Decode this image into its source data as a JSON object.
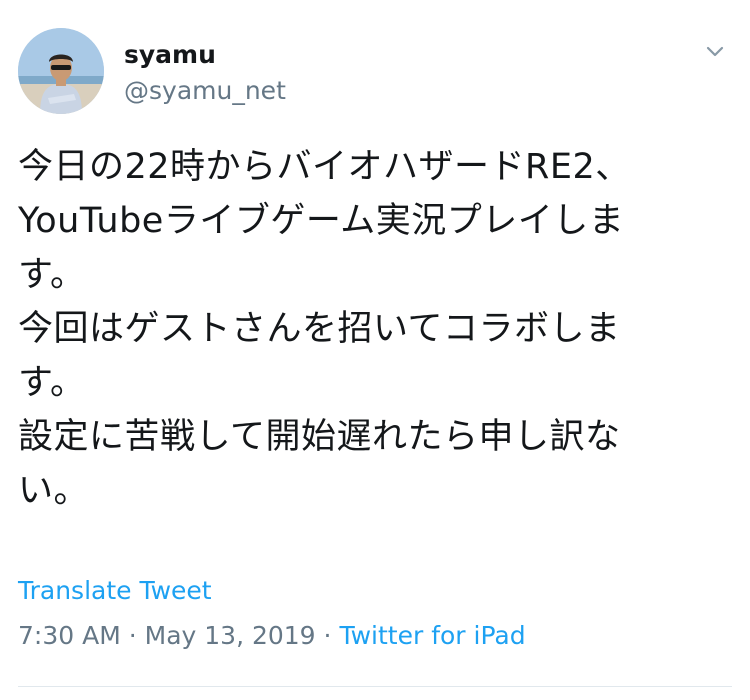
{
  "user": {
    "display_name": "syamu",
    "handle": "@syamu_net"
  },
  "tweet": {
    "text": "今日の22時からバイオハザードRE2、\nYouTubeライブゲーム実況プレイしま\nす。\n今回はゲストさんを招いてコラボしま\nす。\n設定に苦戦して開始遅れたら申し訳な\nい。",
    "translate_label": "Translate Tweet",
    "time": "7:30 AM",
    "separator": "·",
    "date": "May 13, 2019",
    "source": "Twitter for iPad"
  },
  "icons": {
    "menu": "chevron-down-icon"
  },
  "colors": {
    "link": "#1da1f2",
    "secondary_text": "#657786",
    "primary_text": "#14171a",
    "divider": "#e1e8ed"
  }
}
